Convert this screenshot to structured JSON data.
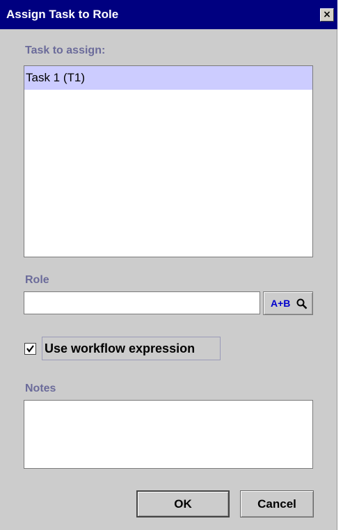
{
  "window": {
    "title": "Assign Task to Role",
    "close_glyph": "×"
  },
  "task_section": {
    "label": "Task to assign:",
    "items": [
      {
        "label": "Task 1 (T1)",
        "selected": true
      }
    ]
  },
  "role_section": {
    "label": "Role",
    "value": "",
    "lookup_button": {
      "label": "A+B",
      "icon": "magnifier-icon"
    }
  },
  "workflow": {
    "checked": true,
    "label": "Use workflow expression"
  },
  "notes_section": {
    "label": "Notes",
    "value": ""
  },
  "buttons": {
    "ok": "OK",
    "cancel": "Cancel"
  },
  "colors": {
    "titlebar": "#000080",
    "dialog_bg": "#cccccc",
    "label_text": "#6b6b9a",
    "selection": "#ccccff",
    "lookup_text": "#0000cc"
  }
}
